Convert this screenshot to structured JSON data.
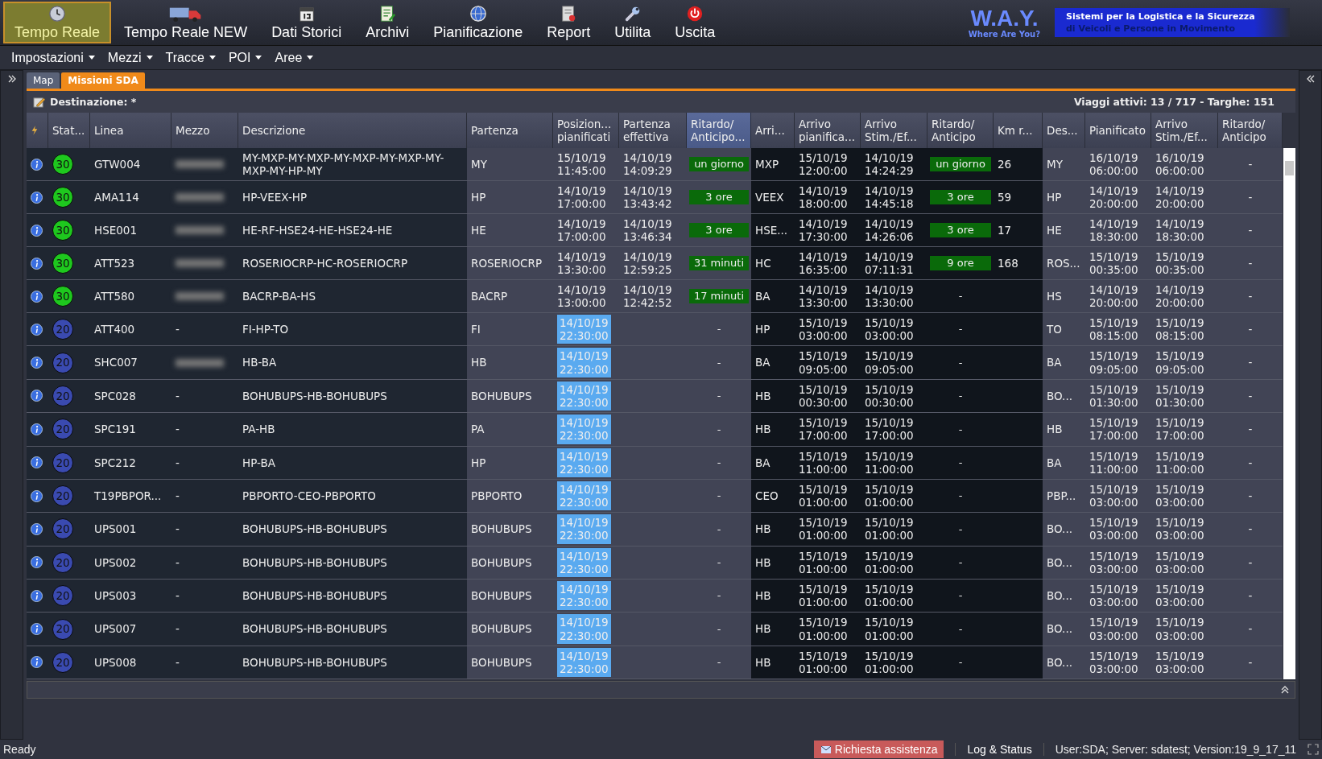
{
  "toolbar": [
    {
      "kind": "clock",
      "label": "Tempo Reale",
      "selected": true
    },
    {
      "kind": "truck",
      "label": "Tempo Reale NEW",
      "selected": false
    },
    {
      "kind": "calendar",
      "label": "Dati Storici",
      "selected": false
    },
    {
      "kind": "notepad",
      "label": "Archivi",
      "selected": false
    },
    {
      "kind": "globe",
      "label": "Pianificazione",
      "selected": false
    },
    {
      "kind": "report",
      "label": "Report",
      "selected": false
    },
    {
      "kind": "wrench",
      "label": "Utilita",
      "selected": false
    },
    {
      "kind": "power",
      "label": "Uscita",
      "selected": false
    }
  ],
  "logo": {
    "name": "W.A.Y.",
    "tagline": "Where Are You?",
    "banner_line_1": "Sistemi per la Logistica e la Sicurezza",
    "banner_line_2": "di Veicoli e Persone in Movimento"
  },
  "menu": [
    "Impostazioni",
    "Mezzi",
    "Tracce",
    "POI",
    "Aree"
  ],
  "tabs": [
    {
      "label": "Map",
      "selected": false
    },
    {
      "label": "Missioni SDA",
      "selected": true
    }
  ],
  "destination": "Destinazione: *",
  "summary": "Viaggi attivi: 13 / 717 - Targhe: 151",
  "columns": [
    {
      "label": "Stat...",
      "sorted": false
    },
    {
      "label": "Linea",
      "sorted": false
    },
    {
      "label": "Mezzo",
      "sorted": false
    },
    {
      "label": "Descrizione",
      "sorted": false
    },
    {
      "label": "Partenza",
      "sorted": false
    },
    {
      "label": "Posizion...\npianificati",
      "sorted": false
    },
    {
      "label": "Partenza\neffettiva",
      "sorted": false
    },
    {
      "label": "Ritardo/\nAnticipo...",
      "sorted": true
    },
    {
      "label": "Arri...",
      "sorted": false
    },
    {
      "label": "Arrivo\npianifica...",
      "sorted": false
    },
    {
      "label": "Arrivo\nStim./Ef...",
      "sorted": false
    },
    {
      "label": "Ritardo/\nAnticipo",
      "sorted": false
    },
    {
      "label": "Km r...",
      "sorted": false
    },
    {
      "label": "Des...",
      "sorted": false
    },
    {
      "label": "Pianificato",
      "sorted": false
    },
    {
      "label": "Arrivo\nStim./Ef...",
      "sorted": false
    },
    {
      "label": "Ritardo/\nAnticipo",
      "sorted": false
    }
  ],
  "rows": [
    {
      "status": "30",
      "color": "#1ec81e",
      "linea": "GTW004",
      "mezzo_blurred": true,
      "descrizione": "MY-MXP-MY-MXP-MY-MXP-MY-MXP-MY-MXP-MY-HP-MY",
      "partenza": "MY",
      "pos": {
        "text": "15/10/19\n11:45:00",
        "highlight": false
      },
      "part_eff": "14/10/19\n14:09:29",
      "rit1": {
        "text": "un giorno",
        "highlight": true
      },
      "arri": "MXP",
      "arr_pian": "15/10/19\n12:00:00",
      "arr_stim": "14/10/19\n14:24:29",
      "rit2": {
        "text": "un giorno",
        "highlight": true
      },
      "km": "26",
      "des": "MY",
      "pianificato": "16/10/19\n06:00:00",
      "arr_stim2": "16/10/19\n06:00:00",
      "rit3": "-"
    },
    {
      "status": "30",
      "color": "#1ec81e",
      "linea": "AMA114",
      "mezzo_blurred": true,
      "descrizione": "HP-VEEX-HP",
      "partenza": "HP",
      "pos": {
        "text": "14/10/19\n17:00:00",
        "highlight": false
      },
      "part_eff": "14/10/19\n13:43:42",
      "rit1": {
        "text": "3 ore",
        "highlight": true
      },
      "arri": "VEEX",
      "arr_pian": "14/10/19\n18:00:00",
      "arr_stim": "14/10/19\n14:45:18",
      "rit2": {
        "text": "3 ore",
        "highlight": true
      },
      "km": "59",
      "des": "HP",
      "pianificato": "14/10/19\n20:00:00",
      "arr_stim2": "14/10/19\n20:00:00",
      "rit3": "-"
    },
    {
      "status": "30",
      "color": "#1ec81e",
      "linea": "HSE001",
      "mezzo_blurred": true,
      "descrizione": "HE-RF-HSE24-HE-HSE24-HE",
      "partenza": "HE",
      "pos": {
        "text": "14/10/19\n17:00:00",
        "highlight": false
      },
      "part_eff": "14/10/19\n13:46:34",
      "rit1": {
        "text": "3 ore",
        "highlight": true
      },
      "arri": "HSE...",
      "arr_pian": "14/10/19\n17:30:00",
      "arr_stim": "14/10/19\n14:26:06",
      "rit2": {
        "text": "3 ore",
        "highlight": true
      },
      "km": "17",
      "des": "HE",
      "pianificato": "14/10/19\n18:30:00",
      "arr_stim2": "14/10/19\n18:30:00",
      "rit3": "-"
    },
    {
      "status": "30",
      "color": "#1ec81e",
      "linea": "ATT523",
      "mezzo_blurred": true,
      "descrizione": "ROSERIOCRP-HC-ROSERIOCRP",
      "partenza": "ROSERIOCRP",
      "pos": {
        "text": "14/10/19\n13:30:00",
        "highlight": false
      },
      "part_eff": "14/10/19\n12:59:25",
      "rit1": {
        "text": "31 minuti",
        "highlight": true
      },
      "arri": "HC",
      "arr_pian": "14/10/19\n16:35:00",
      "arr_stim": "14/10/19\n07:11:31",
      "rit2": {
        "text": "9 ore",
        "highlight": true
      },
      "km": "168",
      "des": "ROS...",
      "pianificato": "15/10/19\n00:35:00",
      "arr_stim2": "15/10/19\n00:35:00",
      "rit3": "-"
    },
    {
      "status": "30",
      "color": "#1ec81e",
      "linea": "ATT580",
      "mezzo_blurred": true,
      "descrizione": "BACRP-BA-HS",
      "partenza": "BACRP",
      "pos": {
        "text": "14/10/19\n13:00:00",
        "highlight": false
      },
      "part_eff": "14/10/19\n12:42:52",
      "rit1": {
        "text": "17 minuti",
        "highlight": true
      },
      "arri": "BA",
      "arr_pian": "14/10/19\n13:30:00",
      "arr_stim": "14/10/19\n13:30:00",
      "rit2": {
        "text": "-",
        "highlight": false
      },
      "des": "HS",
      "pianificato": "14/10/19\n20:00:00",
      "arr_stim2": "14/10/19\n20:00:00",
      "rit3": "-"
    },
    {
      "status": "20",
      "color": "#3a4ab0",
      "linea": "ATT400",
      "mezzo_blurred": false,
      "mezzo": "-",
      "descrizione": "FI-HP-TO",
      "partenza": "FI",
      "pos": {
        "text": "14/10/19\n22:30:00",
        "highlight": true
      },
      "rit1": {
        "text": "-",
        "highlight": false
      },
      "arri": "HP",
      "arr_pian": "15/10/19\n03:00:00",
      "arr_stim": "15/10/19\n03:00:00",
      "rit2": {
        "text": "-",
        "highlight": false
      },
      "des": "TO",
      "pianificato": "15/10/19\n08:15:00",
      "arr_stim2": "15/10/19\n08:15:00",
      "rit3": "-"
    },
    {
      "status": "20",
      "color": "#3a4ab0",
      "linea": "SHC007",
      "mezzo_blurred": true,
      "descrizione": "HB-BA",
      "partenza": "HB",
      "pos": {
        "text": "14/10/19\n22:30:00",
        "highlight": true
      },
      "rit1": {
        "text": "-",
        "highlight": false
      },
      "arri": "BA",
      "arr_pian": "15/10/19\n09:05:00",
      "arr_stim": "15/10/19\n09:05:00",
      "rit2": {
        "text": "-",
        "highlight": false
      },
      "des": "BA",
      "pianificato": "15/10/19\n09:05:00",
      "arr_stim2": "15/10/19\n09:05:00",
      "rit3": "-"
    },
    {
      "status": "20",
      "color": "#3a4ab0",
      "linea": "SPC028",
      "mezzo_blurred": false,
      "mezzo": "-",
      "descrizione": "BOHUBUPS-HB-BOHUBUPS",
      "partenza": "BOHUBUPS",
      "pos": {
        "text": "14/10/19\n22:30:00",
        "highlight": true
      },
      "rit1": {
        "text": "-",
        "highlight": false
      },
      "arri": "HB",
      "arr_pian": "15/10/19\n00:30:00",
      "arr_stim": "15/10/19\n00:30:00",
      "rit2": {
        "text": "-",
        "highlight": false
      },
      "des": "BO...",
      "pianificato": "15/10/19\n01:30:00",
      "arr_stim2": "15/10/19\n01:30:00",
      "rit3": "-"
    },
    {
      "status": "20",
      "color": "#3a4ab0",
      "linea": "SPC191",
      "mezzo_blurred": false,
      "mezzo": "-",
      "descrizione": "PA-HB",
      "partenza": "PA",
      "pos": {
        "text": "14/10/19\n22:30:00",
        "highlight": true
      },
      "rit1": {
        "text": "-",
        "highlight": false
      },
      "arri": "HB",
      "arr_pian": "15/10/19\n17:00:00",
      "arr_stim": "15/10/19\n17:00:00",
      "rit2": {
        "text": "-",
        "highlight": false
      },
      "des": "HB",
      "pianificato": "15/10/19\n17:00:00",
      "arr_stim2": "15/10/19\n17:00:00",
      "rit3": "-"
    },
    {
      "status": "20",
      "color": "#3a4ab0",
      "linea": "SPC212",
      "mezzo_blurred": false,
      "mezzo": "-",
      "descrizione": "HP-BA",
      "partenza": "HP",
      "pos": {
        "text": "14/10/19\n22:30:00",
        "highlight": true
      },
      "rit1": {
        "text": "-",
        "highlight": false
      },
      "arri": "BA",
      "arr_pian": "15/10/19\n11:00:00",
      "arr_stim": "15/10/19\n11:00:00",
      "rit2": {
        "text": "-",
        "highlight": false
      },
      "des": "BA",
      "pianificato": "15/10/19\n11:00:00",
      "arr_stim2": "15/10/19\n11:00:00",
      "rit3": "-"
    },
    {
      "status": "20",
      "color": "#3a4ab0",
      "linea": "T19PBPOR...",
      "mezzo_blurred": false,
      "mezzo": "-",
      "descrizione": "PBPORTO-CEO-PBPORTO",
      "partenza": "PBPORTO",
      "pos": {
        "text": "14/10/19\n22:30:00",
        "highlight": true
      },
      "rit1": {
        "text": "-",
        "highlight": false
      },
      "arri": "CEO",
      "arr_pian": "15/10/19\n01:00:00",
      "arr_stim": "15/10/19\n01:00:00",
      "rit2": {
        "text": "-",
        "highlight": false
      },
      "des": "PBP...",
      "pianificato": "15/10/19\n03:00:00",
      "arr_stim2": "15/10/19\n03:00:00",
      "rit3": "-"
    },
    {
      "status": "20",
      "color": "#3a4ab0",
      "linea": "UPS001",
      "mezzo_blurred": false,
      "mezzo": "-",
      "descrizione": "BOHUBUPS-HB-BOHUBUPS",
      "partenza": "BOHUBUPS",
      "pos": {
        "text": "14/10/19\n22:30:00",
        "highlight": true
      },
      "rit1": {
        "text": "-",
        "highlight": false
      },
      "arri": "HB",
      "arr_pian": "15/10/19\n01:00:00",
      "arr_stim": "15/10/19\n01:00:00",
      "rit2": {
        "text": "-",
        "highlight": false
      },
      "des": "BO...",
      "pianificato": "15/10/19\n03:00:00",
      "arr_stim2": "15/10/19\n03:00:00",
      "rit3": "-"
    },
    {
      "status": "20",
      "color": "#3a4ab0",
      "linea": "UPS002",
      "mezzo_blurred": false,
      "mezzo": "-",
      "descrizione": "BOHUBUPS-HB-BOHUBUPS",
      "partenza": "BOHUBUPS",
      "pos": {
        "text": "14/10/19\n22:30:00",
        "highlight": true
      },
      "rit1": {
        "text": "-",
        "highlight": false
      },
      "arri": "HB",
      "arr_pian": "15/10/19\n01:00:00",
      "arr_stim": "15/10/19\n01:00:00",
      "rit2": {
        "text": "-",
        "highlight": false
      },
      "des": "BO...",
      "pianificato": "15/10/19\n03:00:00",
      "arr_stim2": "15/10/19\n03:00:00",
      "rit3": "-"
    },
    {
      "status": "20",
      "color": "#3a4ab0",
      "linea": "UPS003",
      "mezzo_blurred": false,
      "mezzo": "-",
      "descrizione": "BOHUBUPS-HB-BOHUBUPS",
      "partenza": "BOHUBUPS",
      "pos": {
        "text": "14/10/19\n22:30:00",
        "highlight": true
      },
      "rit1": {
        "text": "-",
        "highlight": false
      },
      "arri": "HB",
      "arr_pian": "15/10/19\n01:00:00",
      "arr_stim": "15/10/19\n01:00:00",
      "rit2": {
        "text": "-",
        "highlight": false
      },
      "des": "BO...",
      "pianificato": "15/10/19\n03:00:00",
      "arr_stim2": "15/10/19\n03:00:00",
      "rit3": "-"
    },
    {
      "status": "20",
      "color": "#3a4ab0",
      "linea": "UPS007",
      "mezzo_blurred": false,
      "mezzo": "-",
      "descrizione": "BOHUBUPS-HB-BOHUBUPS",
      "partenza": "BOHUBUPS",
      "pos": {
        "text": "14/10/19\n22:30:00",
        "highlight": true
      },
      "rit1": {
        "text": "-",
        "highlight": false
      },
      "arri": "HB",
      "arr_pian": "15/10/19\n01:00:00",
      "arr_stim": "15/10/19\n01:00:00",
      "rit2": {
        "text": "-",
        "highlight": false
      },
      "des": "BO...",
      "pianificato": "15/10/19\n03:00:00",
      "arr_stim2": "15/10/19\n03:00:00",
      "rit3": "-"
    },
    {
      "status": "20",
      "color": "#3a4ab0",
      "linea": "UPS008",
      "mezzo_blurred": false,
      "mezzo": "-",
      "descrizione": "BOHUBUPS-HB-BOHUBUPS",
      "partenza": "BOHUBUPS",
      "pos": {
        "text": "14/10/19\n22:30:00",
        "highlight": true
      },
      "rit1": {
        "text": "-",
        "highlight": false
      },
      "arri": "HB",
      "arr_pian": "15/10/19\n01:00:00",
      "arr_stim": "15/10/19\n01:00:00",
      "rit2": {
        "text": "-",
        "highlight": false
      },
      "des": "BO...",
      "pianificato": "15/10/19\n03:00:00",
      "arr_stim2": "15/10/19\n03:00:00",
      "rit3": "-"
    }
  ],
  "status_bar": {
    "state": "Ready",
    "help_button": "Richiesta assistenza",
    "log_button": "Log & Status",
    "info": "User:SDA; Server: sdatest; Version:19_9_17_11"
  }
}
